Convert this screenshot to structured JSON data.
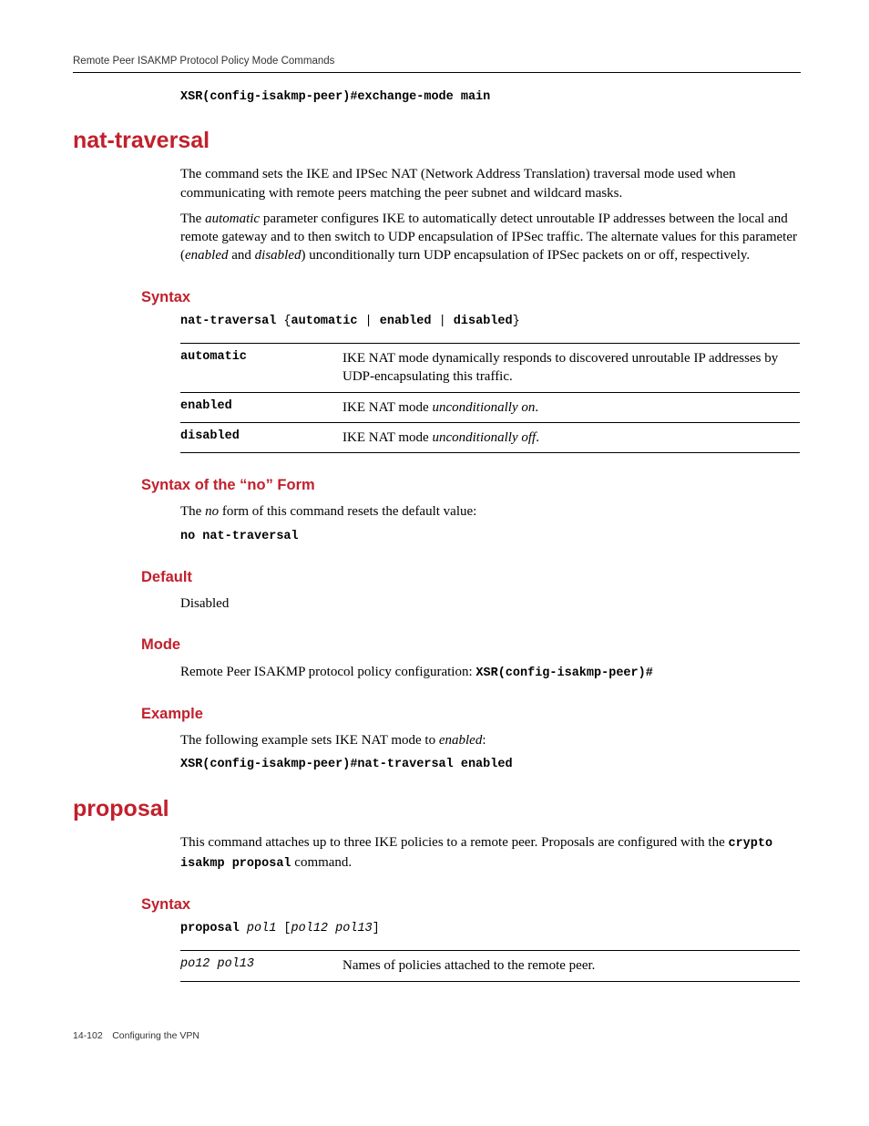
{
  "header": "Remote Peer ISAKMP Protocol Policy Mode Commands",
  "top_example": "XSR(config-isakmp-peer)#exchange-mode main",
  "nat": {
    "title": "nat-traversal",
    "intro1": "The command sets the IKE and IPSec NAT (Network Address Translation) traversal mode used when communicating with remote peers matching the peer subnet and wildcard masks.",
    "intro2_pre": "The ",
    "intro2_em1": "automatic",
    "intro2_mid": " parameter configures IKE to automatically detect unroutable IP addresses between the local and remote gateway and to then switch to UDP encapsulation of IPSec traffic. The alternate values for this parameter (",
    "intro2_em2": "enabled",
    "intro2_and": " and ",
    "intro2_em3": "disabled",
    "intro2_end": ") unconditionally turn UDP encapsulation of IPSec packets on or off, respectively.",
    "syntax_h": "Syntax",
    "syntax_cmd_parts": {
      "a": "nat-traversal",
      "b": " {",
      "c": "automatic",
      "d": " | ",
      "e": "enabled",
      "f": " | ",
      "g": "disabled",
      "h": "}"
    },
    "table": {
      "r1k": "automatic",
      "r1v": "IKE NAT mode dynamically responds to discovered unroutable IP addresses by UDP-encapsulating this traffic.",
      "r2k": "enabled",
      "r2v_pre": "IKE NAT mode ",
      "r2v_em": "unconditionally on",
      "r2v_post": ".",
      "r3k": "disabled",
      "r3v_pre": "IKE NAT mode ",
      "r3v_em": "unconditionally off",
      "r3v_post": "."
    },
    "noform_h": "Syntax of the “no” Form",
    "noform_p_pre": "The ",
    "noform_p_em": "no",
    "noform_p_post": " form of this command resets the default value:",
    "noform_cmd": "no nat-traversal",
    "default_h": "Default",
    "default_v": "Disabled",
    "mode_h": "Mode",
    "mode_p": "Remote Peer ISAKMP protocol policy configuration: ",
    "mode_cmd": "XSR(config-isakmp-peer)#",
    "example_h": "Example",
    "example_p_pre": "The following example sets IKE NAT mode to ",
    "example_p_em": "enabled",
    "example_p_post": ":",
    "example_cmd": "XSR(config-isakmp-peer)#nat-traversal enabled"
  },
  "proposal": {
    "title": "proposal",
    "intro_pre": "This command attaches up to three IKE policies to a remote peer. Proposals are configured with the ",
    "intro_cmd": "crypto isakmp proposal",
    "intro_post": " command.",
    "syntax_h": "Syntax",
    "syntax_parts": {
      "a": "proposal",
      "b": " pol1",
      "c": " [",
      "d": "pol12 pol13",
      "e": "]"
    },
    "table": {
      "k": "po12 pol13",
      "v": "Names of policies attached to the remote peer."
    }
  },
  "footer": "14-102 Configuring the VPN"
}
